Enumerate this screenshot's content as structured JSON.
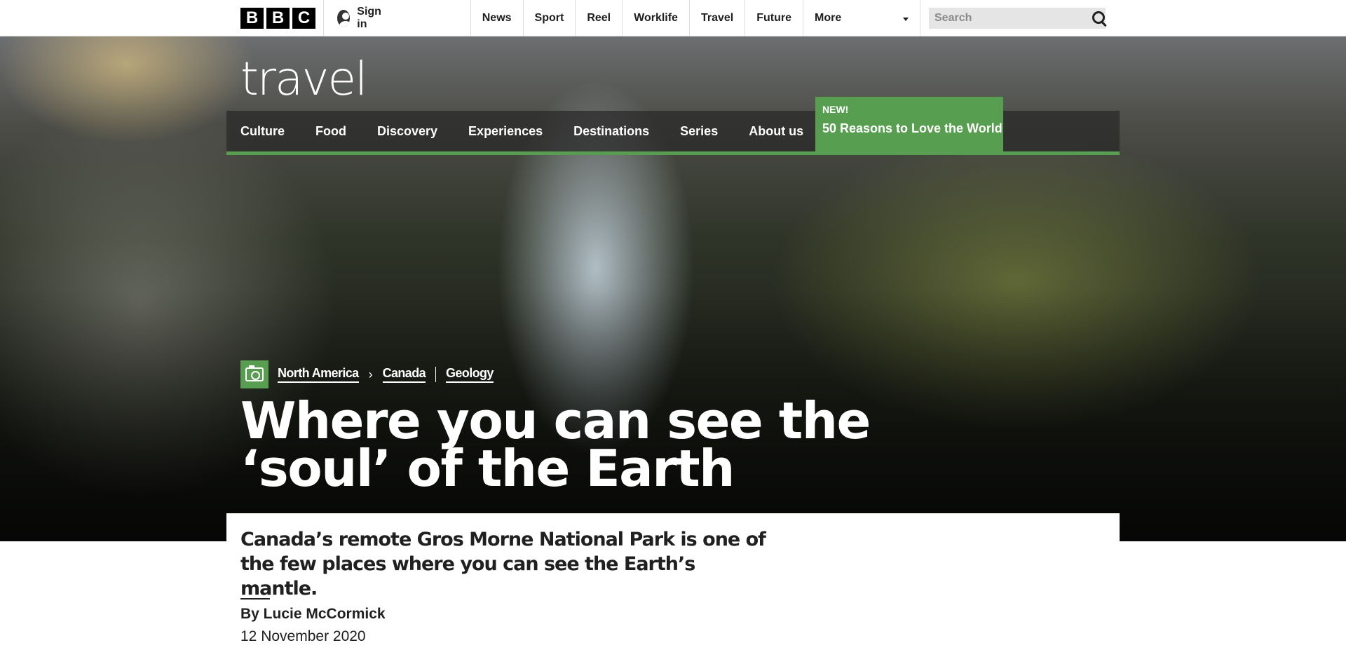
{
  "topbar": {
    "logo_letters": [
      "B",
      "B",
      "C"
    ],
    "signin_label": "Sign in",
    "nav": [
      "News",
      "Sport",
      "Reel",
      "Worklife",
      "Travel",
      "Future"
    ],
    "more_label": "More",
    "search_placeholder": "Search"
  },
  "travel": {
    "logo_text": "travel",
    "nav": [
      "Culture",
      "Food",
      "Discovery",
      "Experiences",
      "Destinations",
      "Series",
      "About us"
    ],
    "promo": {
      "badge": "NEW!",
      "label": "50 Reasons to Love the World"
    },
    "accent_color": "#589e50"
  },
  "article": {
    "breadcrumb": {
      "region": "North America",
      "country": "Canada",
      "topic": "Geology"
    },
    "headline": "Where you can see the ‘soul’ of the Earth",
    "standfirst": "Canada’s remote Gros Morne National Park is one of the few places where you can see the Earth’s mantle.",
    "byline": "By Lucie McCormick",
    "date": "12 November 2020"
  }
}
